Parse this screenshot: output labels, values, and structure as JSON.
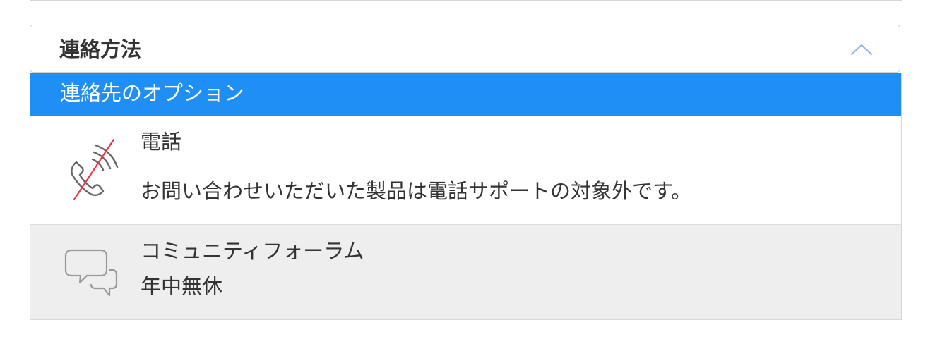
{
  "dropdown": {
    "label": "連絡方法",
    "state_icon": "chevron-up-icon",
    "expanded": true
  },
  "panel": {
    "header": "連絡先のオプション",
    "options": [
      {
        "icon": "phone-disabled-icon",
        "title": "電話",
        "description": "お問い合わせいただいた製品は電話サポートの対象外です。"
      },
      {
        "icon": "chat-bubbles-icon",
        "title": "コミュニティフォーラム",
        "description": "年中無休"
      }
    ]
  },
  "colors": {
    "header_background": "#1f8ff5",
    "chevron": "#8fb8f0",
    "phone_strike": "#ee3344",
    "highlight_row": "#eeeeee"
  }
}
